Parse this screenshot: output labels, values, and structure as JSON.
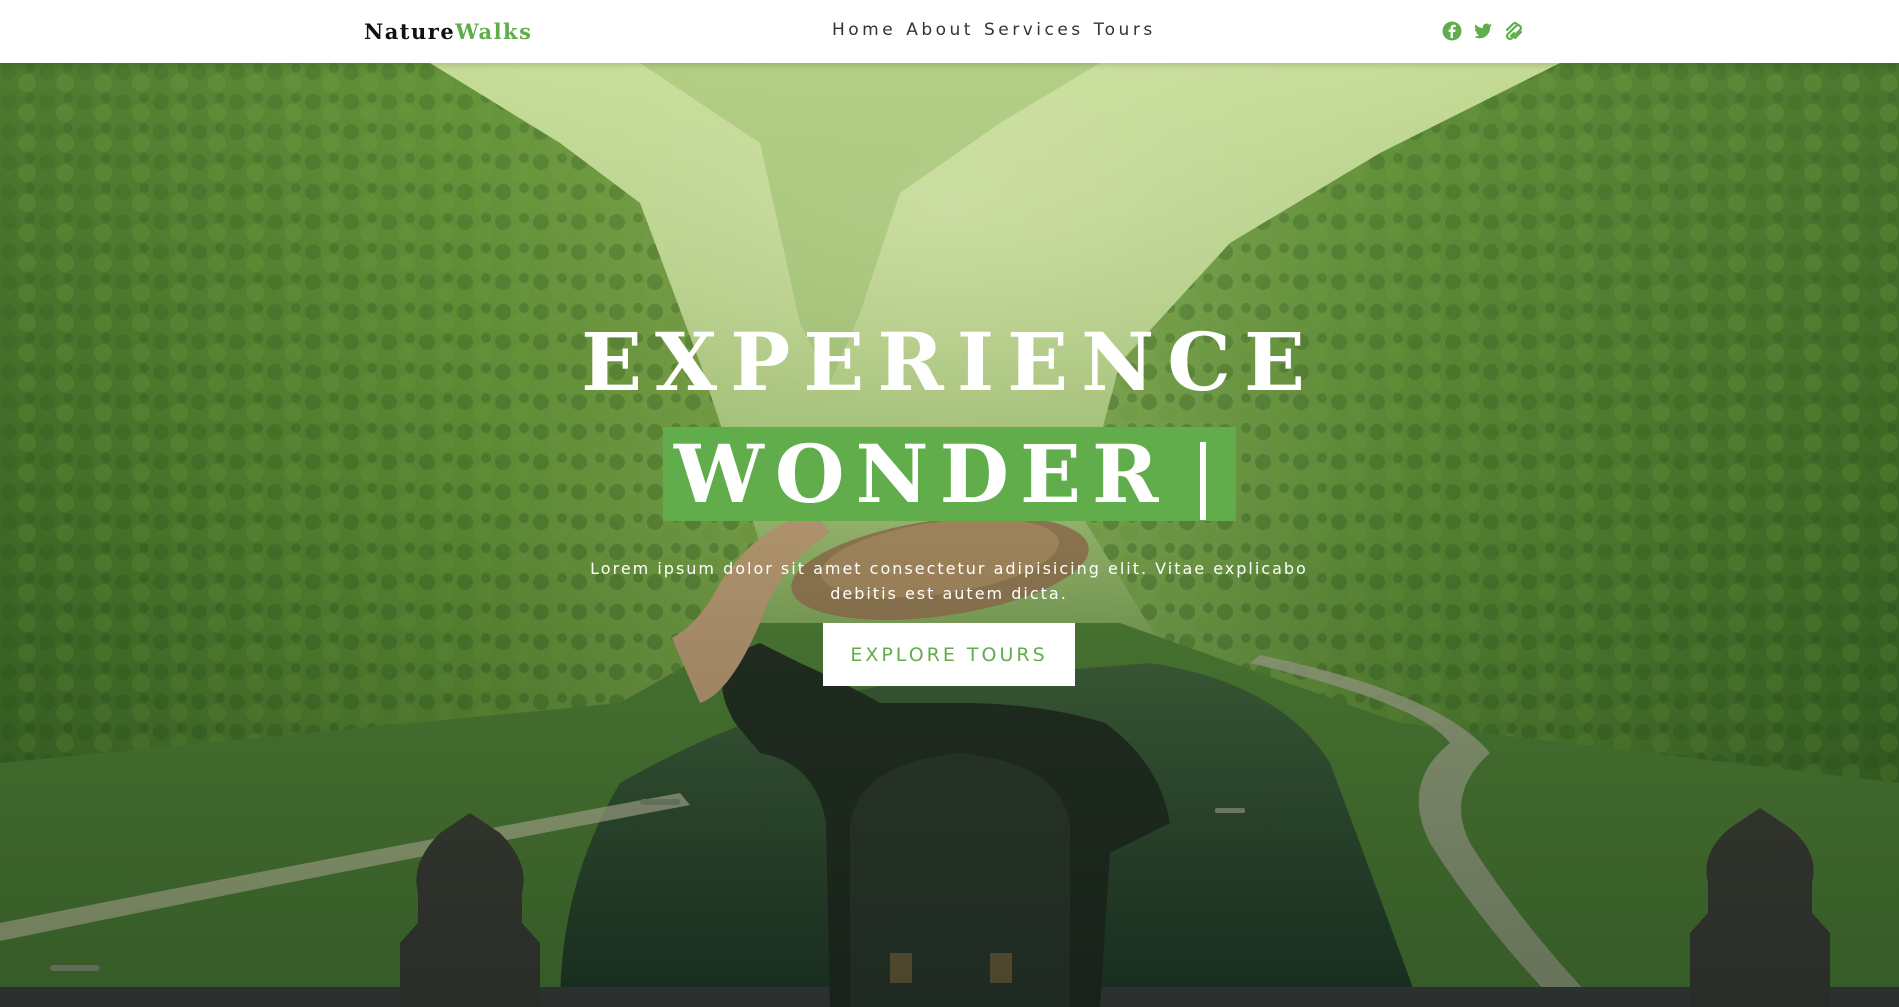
{
  "header": {
    "logo_primary": "Nature",
    "logo_accent": "Walks",
    "nav": [
      "Home",
      "About",
      "Services",
      "Tours"
    ],
    "socials": [
      "facebook-icon",
      "twitter-icon",
      "squarespace-icon"
    ]
  },
  "hero": {
    "title": "EXPERIENCE",
    "typed_word": "WONDER",
    "description": "Lorem ipsum dolor sit amet consectetur adipisicing elit. Vitae explicabo debitis est autem dicta.",
    "cta_label": "EXPLORE TOURS"
  },
  "colors": {
    "accent": "#62ad4b",
    "header_bg": "#ffffff",
    "text_dark": "#333333",
    "hero_text": "#ffffff"
  }
}
